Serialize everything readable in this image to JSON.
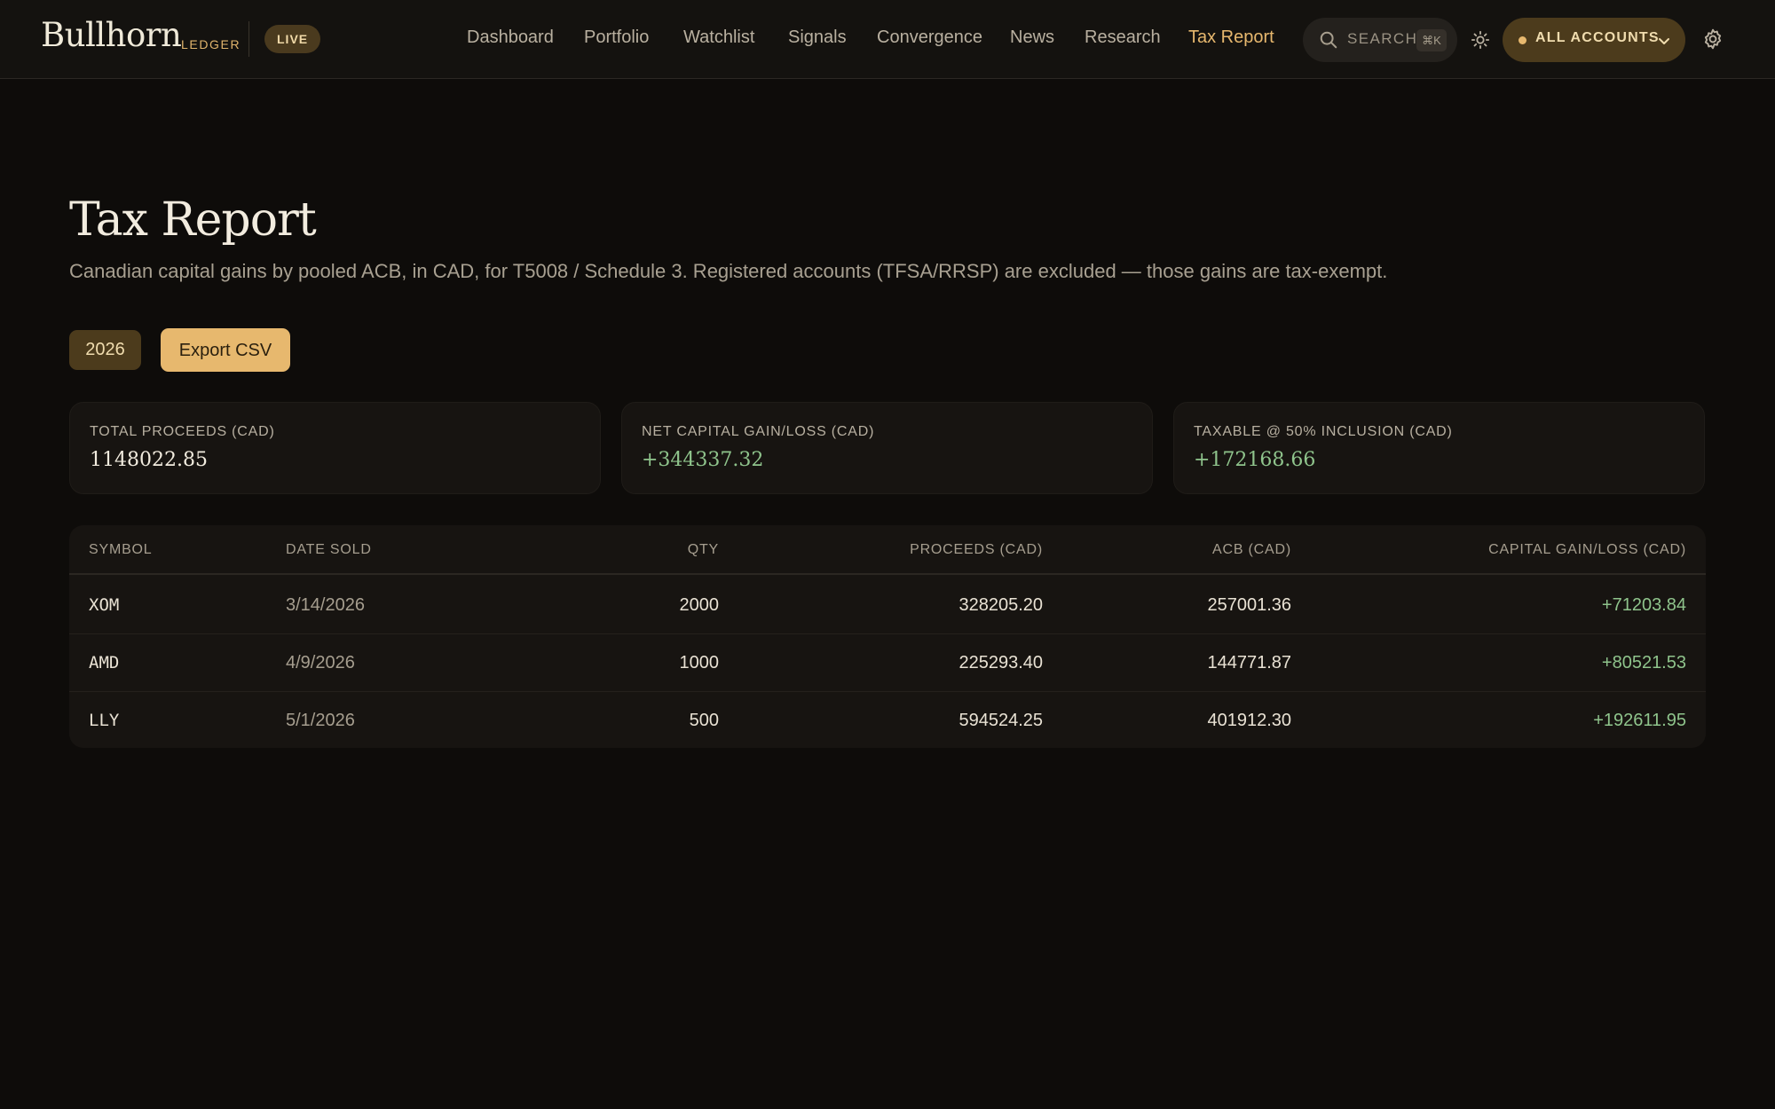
{
  "header": {
    "brand": "Bullhorn",
    "brand_sub": "LEDGER",
    "live_badge": "LIVE",
    "nav": [
      {
        "label": "Dashboard",
        "active": false
      },
      {
        "label": "Portfolio",
        "active": false
      },
      {
        "label": "Watchlist",
        "active": false
      },
      {
        "label": "Signals",
        "active": false
      },
      {
        "label": "Convergence",
        "active": false
      },
      {
        "label": "News",
        "active": false
      },
      {
        "label": "Research",
        "active": false
      },
      {
        "label": "Tax Report",
        "active": true
      }
    ],
    "search": {
      "label": "SEARCH",
      "shortcut": "⌘K",
      "icon": "search-icon"
    },
    "theme_icon": "sun-icon",
    "accounts": {
      "label": "ALL ACCOUNTS",
      "icon": "chevron-down-icon"
    },
    "settings_icon": "gear-icon"
  },
  "main": {
    "title": "Tax Report",
    "subtitle": "Canadian capital gains by pooled ACB, in CAD, for T5008 / Schedule 3. Registered accounts (TFSA/RRSP) are excluded — those gains are tax-exempt.",
    "year": "2026",
    "export_label": "Export CSV",
    "cards": [
      {
        "label": "TOTAL PROCEEDS (CAD)",
        "value": "1148022.85",
        "positive": false
      },
      {
        "label": "NET CAPITAL GAIN/LOSS (CAD)",
        "value": "+344337.32",
        "positive": true
      },
      {
        "label": "TAXABLE @ 50% INCLUSION (CAD)",
        "value": "+172168.66",
        "positive": true
      }
    ],
    "table": {
      "columns": [
        "SYMBOL",
        "DATE SOLD",
        "QTY",
        "PROCEEDS (CAD)",
        "ACB (CAD)",
        "CAPITAL GAIN/LOSS (CAD)"
      ],
      "rows": [
        {
          "symbol": "XOM",
          "date": "3/14/2026",
          "qty": "2000",
          "proceeds": "328205.20",
          "acb": "257001.36",
          "gain": "+71203.84"
        },
        {
          "symbol": "AMD",
          "date": "4/9/2026",
          "qty": "1000",
          "proceeds": "225293.40",
          "acb": "144771.87",
          "gain": "+80521.53"
        },
        {
          "symbol": "LLY",
          "date": "5/1/2026",
          "qty": "500",
          "proceeds": "594524.25",
          "acb": "401912.30",
          "gain": "+192611.95"
        }
      ]
    }
  },
  "colors": {
    "background": "#0e0c0a",
    "accent": "#e7b86e",
    "positive": "#8fc48c"
  }
}
